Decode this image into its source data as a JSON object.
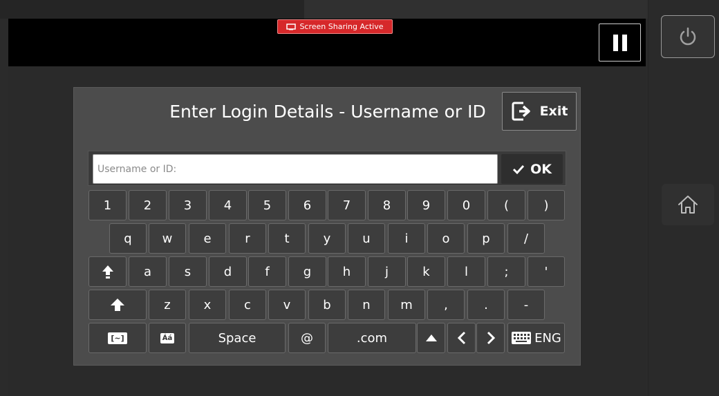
{
  "topbar": {
    "share_badge": "Screen Sharing Active",
    "share_color": "#d6282a",
    "pause_icon": "pause-icon"
  },
  "side": {
    "power_icon": "power-icon",
    "home_icon": "home-icon"
  },
  "dialog": {
    "title": "Enter Login Details - Username or ID",
    "exit_label": "Exit",
    "input_value": "",
    "input_placeholder": "Username or ID:",
    "ok_label": "OK"
  },
  "keyboard": {
    "row1": [
      "1",
      "2",
      "3",
      "4",
      "5",
      "6",
      "7",
      "8",
      "9",
      "0",
      "(",
      ")"
    ],
    "row2": [
      "q",
      "w",
      "e",
      "r",
      "t",
      "y",
      "u",
      "i",
      "o",
      "p",
      "/"
    ],
    "row3": [
      "a",
      "s",
      "d",
      "f",
      "g",
      "h",
      "j",
      "k",
      "l",
      ";",
      "'"
    ],
    "row4": [
      "z",
      "x",
      "c",
      "v",
      "b",
      "n",
      "m",
      ",",
      ".",
      "-"
    ],
    "caps_lock_icon": "caps-lock-icon",
    "shift_icon": "shift-icon",
    "special_label": "[~]",
    "accent_label": "Áá",
    "space_label": "Space",
    "at_label": "@",
    "dotcom_label": ".com",
    "up_icon": "up-arrow-icon",
    "left_icon": "left-arrow-icon",
    "right_icon": "right-arrow-icon",
    "lang_label": "ENG",
    "lang_icon": "keyboard-icon"
  }
}
